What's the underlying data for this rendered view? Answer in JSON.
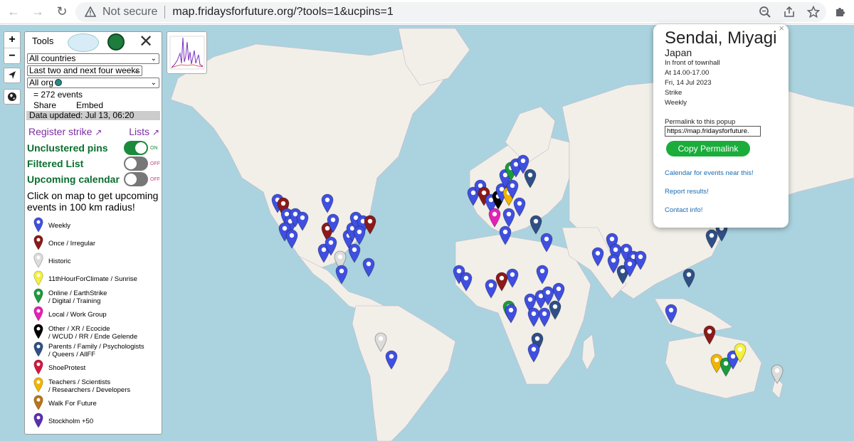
{
  "browser": {
    "security_status": "Not secure",
    "url": "map.fridaysforfuture.org/?tools=1&ucpins=1"
  },
  "zoom": {
    "in_label": "+",
    "out_label": "−"
  },
  "tools": {
    "title": "Tools",
    "close_label": "✕",
    "country_filter": "All countries",
    "date_filter": "Last two and next four weeks",
    "org_filter": "All org",
    "events_count": "= 272 events",
    "share_label": "Share",
    "embed_label": "Embed",
    "data_updated": "Data updated: Jul 13, 06:20",
    "register_strike": "Register strike",
    "lists_label": "Lists",
    "toggles": [
      {
        "label": "Unclustered pins",
        "state": "ON"
      },
      {
        "label": "Filtered List",
        "state": "OFF"
      },
      {
        "label": "Upcoming calendar",
        "state": "OFF"
      }
    ],
    "hint": "Click on map to get upcoming events in 100 km radius!",
    "legend": [
      {
        "label": "Weekly",
        "color": "#3f4fe0"
      },
      {
        "label": "Once / Irregular",
        "color": "#8b1a1a"
      },
      {
        "label": "Historic",
        "color": "#dcdcdc"
      },
      {
        "label": "11thHourForClimate / Sunrise",
        "color": "#f5f03a"
      },
      {
        "label": "Online / EarthStrike / Digital / Training",
        "color": "#1c9a3c"
      },
      {
        "label": "Local / Work Group",
        "color": "#e61fb8"
      },
      {
        "label": "Other / XR / Ecocide / WCUD / RR / Ende Gelende",
        "color": "#000000"
      },
      {
        "label": "Parents / Family / Psychologists / Queers / AllFF",
        "color": "#2f4f86"
      },
      {
        "label": "ShoeProtest",
        "color": "#d3163f"
      },
      {
        "label": "Teachers / Scientists / Researchers / Developers",
        "color": "#f2b400"
      },
      {
        "label": "Walk For Future",
        "color": "#b7741a"
      },
      {
        "label": "Stockholm +50",
        "color": "#5b2fb0"
      }
    ]
  },
  "popup": {
    "close_label": "×",
    "city": "Sendai, Miyagi",
    "country": "Japan",
    "place": "In front of townhall",
    "time": "At 14.00-17.00",
    "date": "Fri, 14 Jul 2023",
    "type": "Strike",
    "frequency": "Weekly",
    "permalink_label": "Permalink to this popup",
    "permalink_value": "https://map.fridaysforfuture.",
    "copy_button": "Copy Permalink",
    "calendar_link": "Calendar for events near this!",
    "report_link": "Report results!",
    "contact_link": "Contact info!"
  },
  "colors": {
    "ocean": "#aad3df",
    "land": "#f2efe9",
    "weekly": "#3f4fe0",
    "once": "#8b1a1a",
    "historic": "#dcdcdc",
    "online": "#1c9a3c",
    "local": "#e61fb8",
    "other": "#000000",
    "parents": "#2f4f86",
    "teachers": "#f2b400",
    "sunrise": "#f5f03a"
  }
}
